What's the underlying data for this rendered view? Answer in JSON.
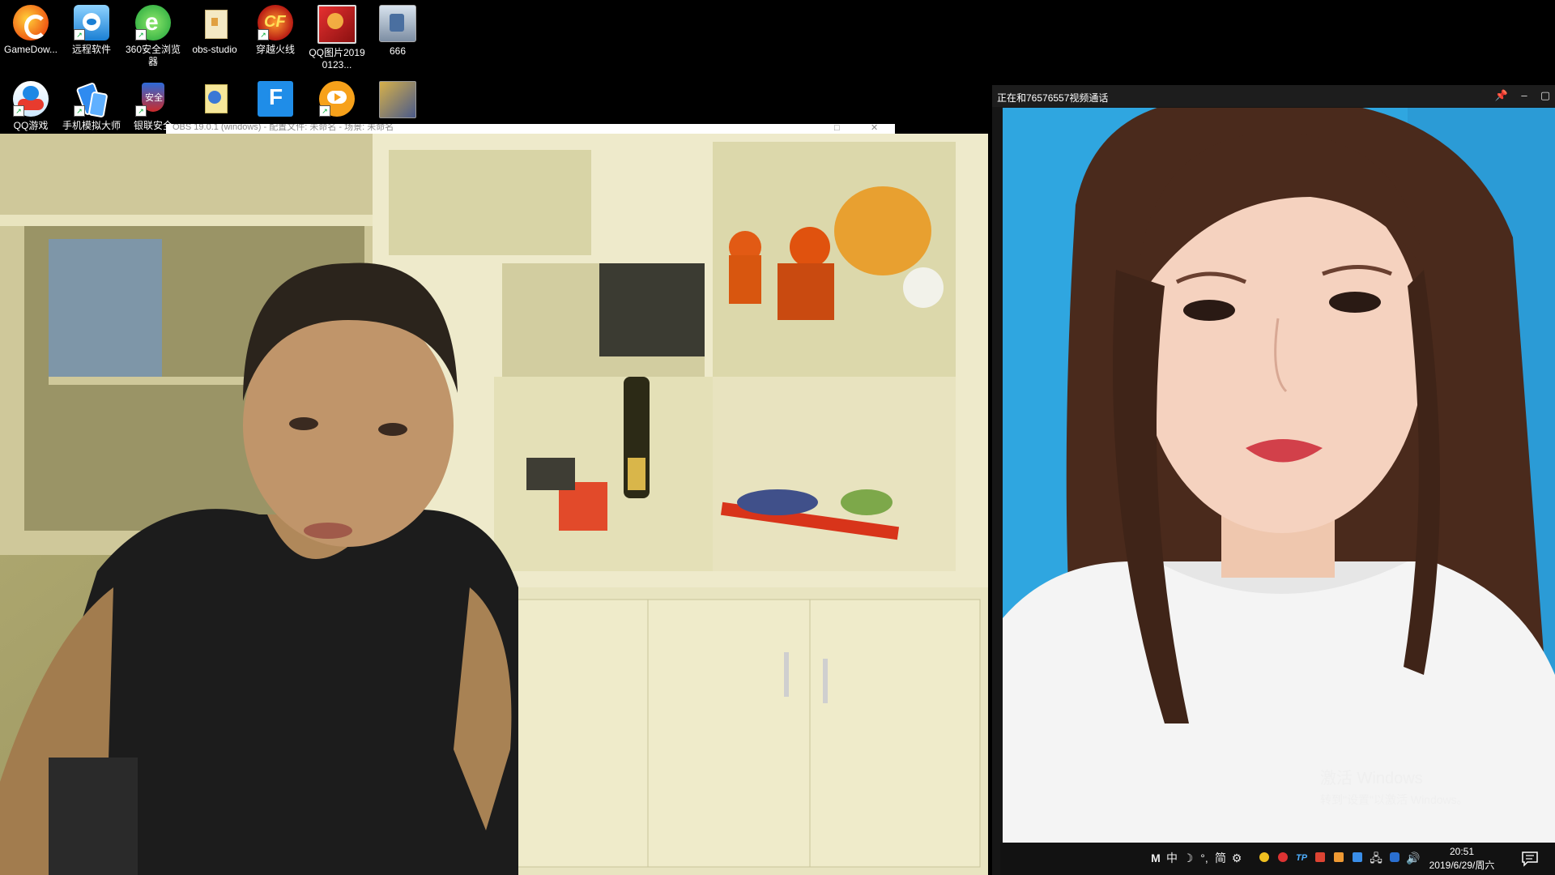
{
  "desktop": {
    "icons": [
      {
        "label": "GameDow...",
        "icon": "gamedownload-icon"
      },
      {
        "label": "远程软件",
        "icon": "remote-software-icon"
      },
      {
        "label": "360安全浏览器",
        "icon": "360-browser-icon"
      },
      {
        "label": "obs-studio",
        "icon": "folder-icon"
      },
      {
        "label": "穿越火线",
        "icon": "crossfire-icon"
      },
      {
        "label": "QQ图片20190123...",
        "icon": "image-file-icon"
      },
      {
        "label": "666",
        "icon": "file-icon"
      },
      {
        "label": "QQ游戏",
        "icon": "qq-game-icon"
      },
      {
        "label": "手机模拟大师",
        "icon": "phone-emulator-icon"
      },
      {
        "label": "银联安全",
        "icon": "unionpay-security-icon"
      },
      {
        "label": "",
        "icon": "document-icon"
      },
      {
        "label": "",
        "icon": "f-app-icon"
      },
      {
        "label": "",
        "icon": "video-app-icon"
      },
      {
        "label": "",
        "icon": "image-thumb-icon"
      }
    ]
  },
  "obs_window": {
    "title_partial": "OBS 19.0.1 (windows) - 配置文件: 未命名 - 场景: 未命名",
    "colors": {
      "bar": "#ffffff"
    }
  },
  "video_call": {
    "title": "正在和76576557视频通话",
    "pin_icon": "pin-icon",
    "minimize_icon": "minimize-icon",
    "maximize_icon": "maximize-icon",
    "bg_color": "#2fa6e0"
  },
  "watermark": {
    "line1": "激活 Windows",
    "line2": "转到\"设置\"以激活 Windows。"
  },
  "taskbar": {
    "ime": [
      "M",
      "中",
      "☽",
      "°,",
      "简",
      "⚙"
    ],
    "clock_time": "20:51",
    "clock_date": "2019/6/29/周六",
    "notification_icon": "notification-icon"
  }
}
